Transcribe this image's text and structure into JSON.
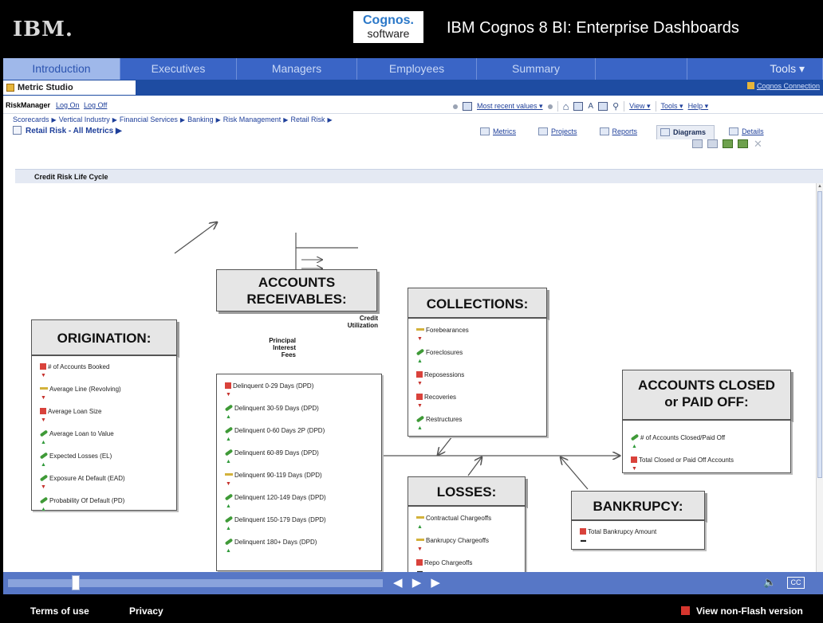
{
  "header": {
    "brand": "IBM.",
    "cognos_line1": "Cognos.",
    "cognos_line2": "software",
    "title": "IBM Cognos 8 BI: Enterprise Dashboards"
  },
  "main_nav": {
    "tabs": [
      {
        "label": "Introduction",
        "active": true
      },
      {
        "label": "Executives"
      },
      {
        "label": "Managers"
      },
      {
        "label": "Employees"
      },
      {
        "label": "Summary"
      },
      {
        "label": ""
      },
      {
        "label": "Tools ▾"
      }
    ]
  },
  "studio": {
    "tab": "Metric Studio",
    "connection": "Cognos Connection"
  },
  "toolbar": {
    "user": "RiskManager",
    "log_on": "Log On",
    "log_off": "Log Off",
    "values_menu": "Most recent values ▾",
    "view_menu": "View ▾",
    "tools_menu": "Tools ▾",
    "help_menu": "Help ▾"
  },
  "breadcrumb": [
    "Scorecards",
    "Vertical Industry",
    "Financial Services",
    "Banking",
    "Risk Management",
    "Retail Risk"
  ],
  "page_title": "Retail Risk - All Metrics ▶",
  "view_tabs": [
    "Metrics",
    "Projects",
    "Reports",
    "Diagrams",
    "Details"
  ],
  "active_view_tab": "Diagrams",
  "section_title": "Credit Risk Life Cycle",
  "diagram": {
    "origination": {
      "title": "ORIGINATION:",
      "metrics": [
        {
          "label": "# of Accounts Booked",
          "status": "red",
          "trend": "down"
        },
        {
          "label": "Average Line (Revolving)",
          "status": "yellow",
          "trend": "down"
        },
        {
          "label": "Average Loan Size",
          "status": "red",
          "trend": "down"
        },
        {
          "label": "Average Loan to Value",
          "status": "green",
          "trend": "up"
        },
        {
          "label": "Expected Losses (EL)",
          "status": "green",
          "trend": "up"
        },
        {
          "label": "Exposure At Default (EAD)",
          "status": "green",
          "trend": "down"
        },
        {
          "label": "Probability Of Default (PD)",
          "status": "green",
          "trend": "up"
        }
      ]
    },
    "receivables": {
      "title_line1": "ACCOUNTS",
      "title_line2": "RECEIVABLES:",
      "credit_label": "Credit\nUtilization",
      "flow_label": "Principal\nInterest\nFees",
      "metrics": [
        {
          "label": "Delinquent 0-29 Days (DPD)",
          "status": "red",
          "trend": "down"
        },
        {
          "label": "Delinquent 30-59 Days (DPD)",
          "status": "green",
          "trend": "up"
        },
        {
          "label": "Delinquent 0-60 Days 2P (DPD)",
          "status": "green",
          "trend": "up"
        },
        {
          "label": "Delinquent 60-89 Days (DPD)",
          "status": "green",
          "trend": "up"
        },
        {
          "label": "Delinquent 90-119 Days (DPD)",
          "status": "yellow",
          "trend": "down"
        },
        {
          "label": "Delinquent 120-149 Days (DPD)",
          "status": "green",
          "trend": "up"
        },
        {
          "label": "Delinquent 150-179 Days (DPD)",
          "status": "green",
          "trend": "up"
        },
        {
          "label": "Delinquent 180+ Days (DPD)",
          "status": "green",
          "trend": "up"
        }
      ]
    },
    "collections": {
      "title": "COLLECTIONS:",
      "metrics": [
        {
          "label": "Forebearances",
          "status": "yellow",
          "trend": "down"
        },
        {
          "label": "Foreclosures",
          "status": "green",
          "trend": "up"
        },
        {
          "label": "Reposessions",
          "status": "red",
          "trend": "down"
        },
        {
          "label": "Recoveries",
          "status": "red",
          "trend": "down"
        },
        {
          "label": "Restructures",
          "status": "green",
          "trend": "up"
        }
      ]
    },
    "losses": {
      "title": "LOSSES:",
      "metrics": [
        {
          "label": "Contractual Chargeoffs",
          "status": "yellow",
          "trend": "up"
        },
        {
          "label": "Bankrupcy Chargeoffs",
          "status": "yellow",
          "trend": "down"
        },
        {
          "label": "Repo Chargeoffs",
          "status": "red",
          "trend": "flat"
        }
      ]
    },
    "bankruptcy": {
      "title": "BANKRUPCY:",
      "metrics": [
        {
          "label": "Total Bankrupcy Amount",
          "status": "red",
          "trend": "flat"
        }
      ]
    },
    "closed": {
      "title_line1": "ACCOUNTS CLOSED",
      "title_line2": "or PAID OFF:",
      "metrics": [
        {
          "label": "# of Accounts Closed/Paid Off",
          "status": "green",
          "trend": "up"
        },
        {
          "label": "Total Closed or Paid Off Accounts",
          "status": "red",
          "trend": "down"
        }
      ]
    }
  },
  "player": {
    "controls": "◀ ▶ ▶",
    "cc": "CC",
    "progress": 0.17
  },
  "footer": {
    "terms": "Terms of use",
    "privacy": "Privacy",
    "non_flash": "View non-Flash version"
  },
  "colors": {
    "nav": "#3a65c6",
    "studio_bar": "#1e4ca2",
    "status_red": "#d9423b",
    "status_green": "#3f9a37",
    "status_yellow": "#d3b23b"
  }
}
